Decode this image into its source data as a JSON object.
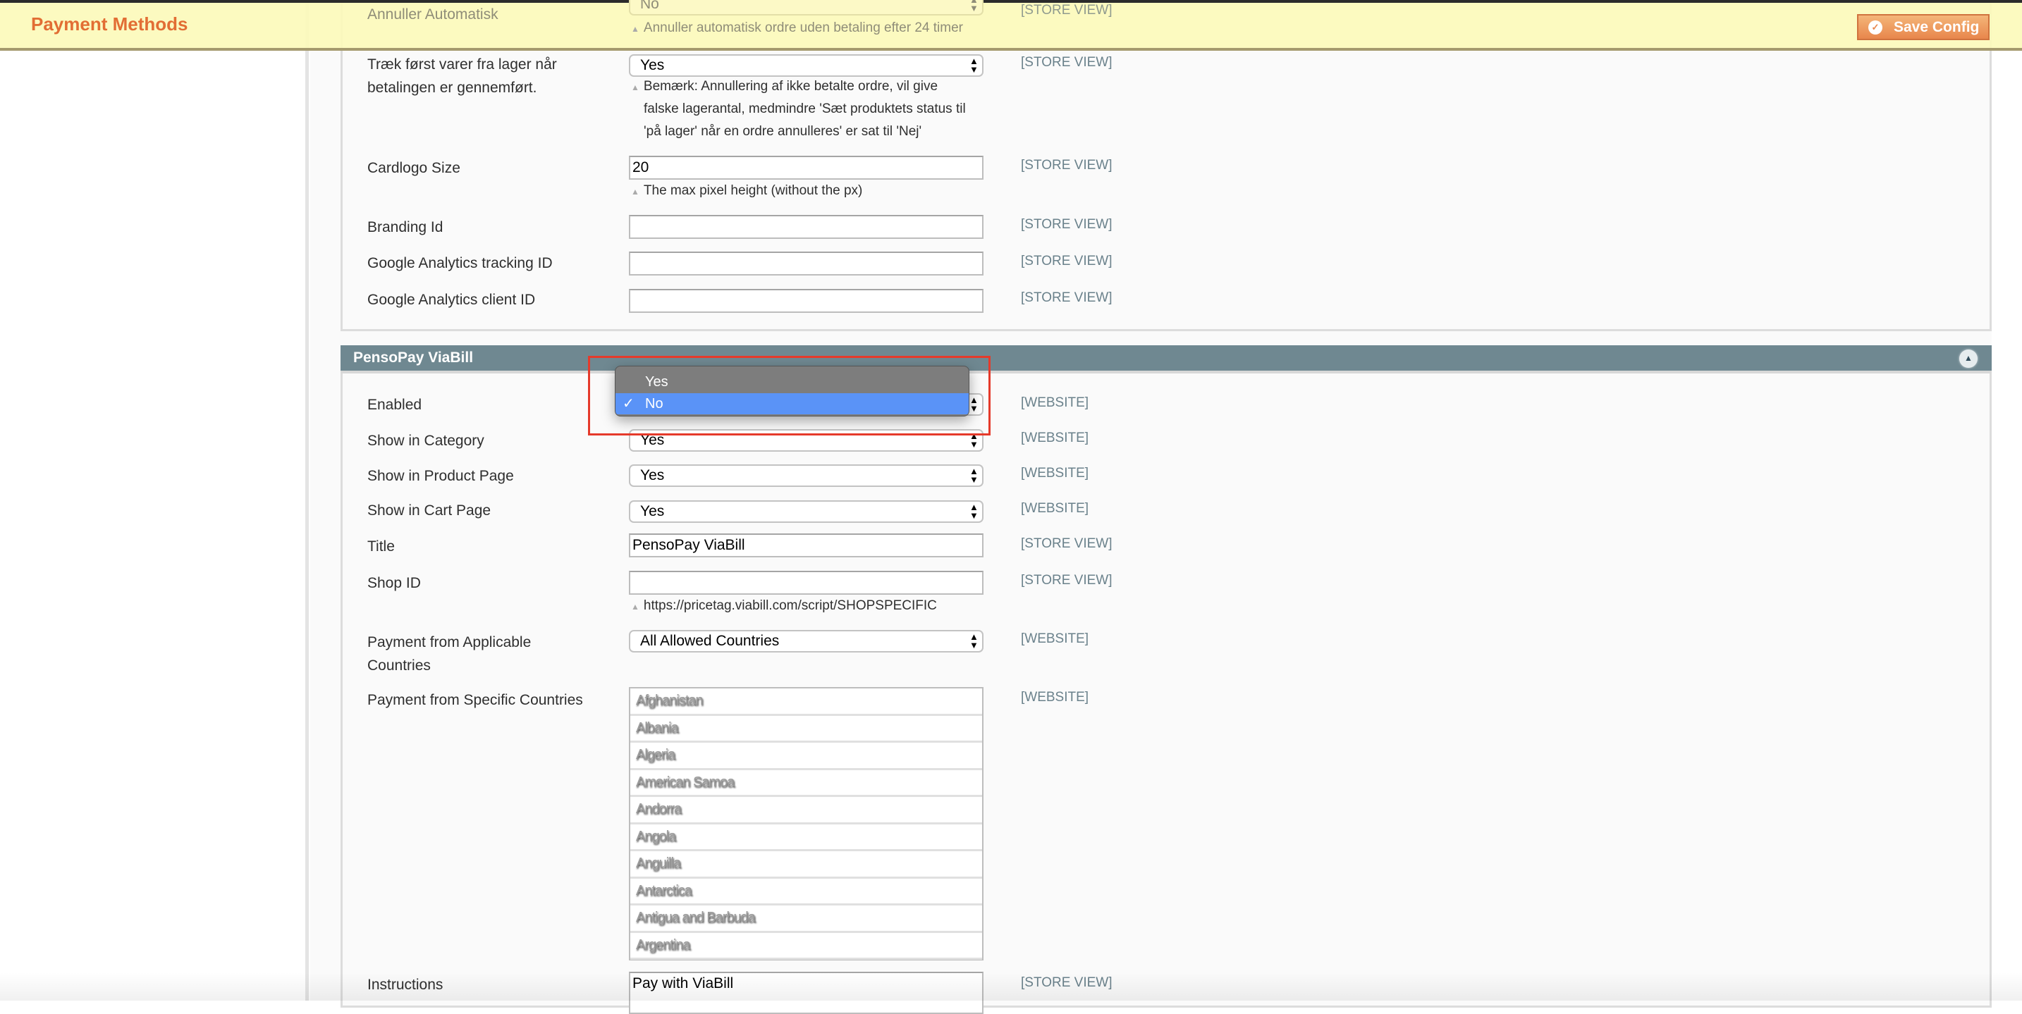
{
  "header": {
    "title": "Payment Methods",
    "save_label": "Save Config",
    "colors": {
      "title": "#e26e34",
      "button": "#ea8a4e",
      "background": "#fcf9bc"
    }
  },
  "top_section": {
    "fields": [
      {
        "label": "Annuller Automatisk",
        "value": "No",
        "note": "Annuller automatisk ordre uden betaling efter 24 timer",
        "scope": "[STORE VIEW]"
      },
      {
        "label_line1": "Træk først varer fra lager når",
        "label_line2": "betalingen er gennemført.",
        "value": "Yes",
        "note_lines": [
          "Bemærk: Annullering af ikke betalte ordre, vil give",
          "falske lagerantal, medmindre 'Sæt produktets status til",
          "'på lager' når en ordre annulleres' er sat til 'Nej'"
        ],
        "scope": "[STORE VIEW]"
      },
      {
        "label": "Cardlogo Size",
        "value": "20",
        "note": "The max pixel height (without the px)",
        "scope": "[STORE VIEW]"
      },
      {
        "label": "Branding Id",
        "value": "",
        "scope": "[STORE VIEW]"
      },
      {
        "label": "Google Analytics tracking ID",
        "value": "",
        "scope": "[STORE VIEW]"
      },
      {
        "label": "Google Analytics client ID",
        "value": "",
        "scope": "[STORE VIEW]"
      }
    ]
  },
  "viabill": {
    "title": "PensoPay ViaBill",
    "fields": [
      {
        "label": "Enabled",
        "value": "No",
        "scope": "[WEBSITE]"
      },
      {
        "label": "Show in Category",
        "value": "Yes",
        "scope": "[WEBSITE]"
      },
      {
        "label": "Show in Product Page",
        "value": "Yes",
        "scope": "[WEBSITE]"
      },
      {
        "label": "Show in Cart Page",
        "value": "Yes",
        "scope": "[WEBSITE]"
      },
      {
        "label": "Title",
        "value": "PensoPay ViaBill",
        "scope": "[STORE VIEW]"
      },
      {
        "label": "Shop ID",
        "value": "",
        "note": "https://pricetag.viabill.com/script/SHOPSPECIFIC",
        "scope": "[STORE VIEW]"
      },
      {
        "label_line1": "Payment from Applicable",
        "label_line2": "Countries",
        "value": "All Allowed Countries",
        "scope": "[WEBSITE]"
      },
      {
        "label": "Payment from Specific Countries",
        "scope": "[WEBSITE]"
      },
      {
        "label": "Instructions",
        "value": "Pay with ViaBill",
        "scope": "[STORE VIEW]"
      }
    ],
    "countries": [
      "Afghanistan",
      "Albania",
      "Algeria",
      "American Samoa",
      "Andorra",
      "Angola",
      "Anguilla",
      "Antarctica",
      "Antigua and Barbuda",
      "Argentina"
    ],
    "dropdown": {
      "options": [
        "Yes",
        "No"
      ],
      "selected": "No",
      "check": "✓",
      "colors": {
        "highlight": "#5a93f7",
        "menu": "#7d7d7d",
        "annotation": "#e53a2b"
      }
    }
  }
}
